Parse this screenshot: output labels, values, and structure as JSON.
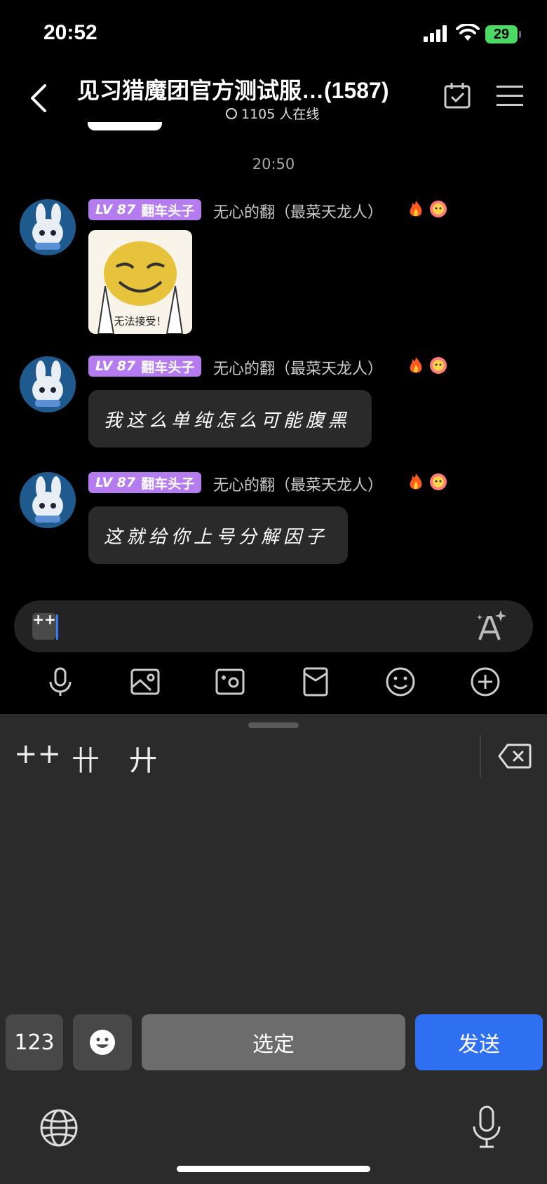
{
  "status_bar": {
    "time": "20:52",
    "battery": "29"
  },
  "header": {
    "title": "见习猎魔团官方测试服…(1587)",
    "online": "1105 人在线"
  },
  "timestamp": "20:50",
  "messages": [
    {
      "level": "LV 87",
      "badge": "翻车头子",
      "username": "无心的翻（最菜天龙人）",
      "type": "sticker",
      "sticker_caption": "无法接受！"
    },
    {
      "level": "LV 87",
      "badge": "翻车头子",
      "username": "无心的翻（最菜天龙人）",
      "type": "text",
      "text": "我这么单纯怎么可能腹黑"
    },
    {
      "level": "LV 87",
      "badge": "翻车头子",
      "username": "无心的翻（最菜天龙人）",
      "type": "text",
      "text": "这就给你上号分解因子"
    }
  ],
  "input": {
    "chip": "++"
  },
  "toolbar": [
    "mic-icon",
    "image-icon",
    "camera-icon",
    "red-packet-icon",
    "smiley-icon",
    "plus-icon"
  ],
  "keyboard": {
    "candidates": [
      "++",
      "卄",
      "廾"
    ],
    "key_123": "123",
    "key_select": "选定",
    "key_send": "发送"
  },
  "colors": {
    "badge": "#b57cf0",
    "send": "#2f6ff1",
    "battery": "#4cd964",
    "cursor": "#3a7bf5"
  }
}
